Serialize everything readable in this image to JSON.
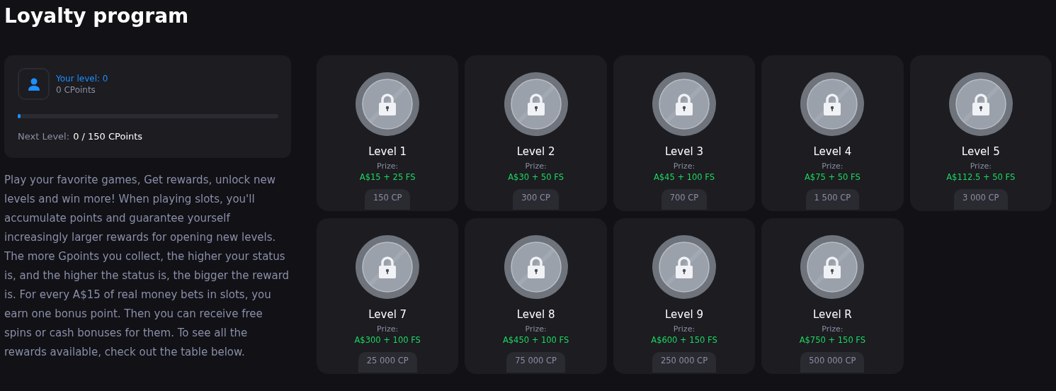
{
  "title": "Loyalty program",
  "status": {
    "level_label": "Your level: 0",
    "points": "0 CPoints",
    "progress": {
      "level": 0
    },
    "next_label": "Next Level:",
    "next_value": "0 / 150 CPoints"
  },
  "description": "Play your favorite games, Get rewards, unlock new levels and win more! When playing slots, you'll accumulate points and guarantee yourself increasingly larger rewards for opening new levels. The more Gpoints you collect, the higher your status is, and the higher the status is, the bigger the reward is. For every A$15 of real money bets in slots, you earn one bonus point. Then you can receive free spins or cash bonuses for them. To see all the rewards available, check out the table below.",
  "levels": [
    {
      "name": "Level 1",
      "prize_label": "Prize:",
      "prize": "A$15 + 25 FS",
      "cost": "150 CP",
      "locked": true
    },
    {
      "name": "Level 2",
      "prize_label": "Prize:",
      "prize": "A$30 + 50 FS",
      "cost": "300 CP",
      "locked": true
    },
    {
      "name": "Level 3",
      "prize_label": "Prize:",
      "prize": "A$45 + 100 FS",
      "cost": "700 CP",
      "locked": true
    },
    {
      "name": "Level 4",
      "prize_label": "Prize:",
      "prize": "A$75 + 50 FS",
      "cost": "1 500 CP",
      "locked": true
    },
    {
      "name": "Level 5",
      "prize_label": "Prize:",
      "prize": "A$112.5 + 50 FS",
      "cost": "3 000 CP",
      "locked": true
    },
    {
      "name": "Level 7",
      "prize_label": "Prize:",
      "prize": "A$300 + 100 FS",
      "cost": "25 000 CP",
      "locked": true
    },
    {
      "name": "Level 8",
      "prize_label": "Prize:",
      "prize": "A$450 + 100 FS",
      "cost": "75 000 CP",
      "locked": true
    },
    {
      "name": "Level 9",
      "prize_label": "Prize:",
      "prize": "A$600 + 150 FS",
      "cost": "250 000 CP",
      "locked": true
    },
    {
      "name": "Level R",
      "prize_label": "Prize:",
      "prize": "A$750 + 150 FS",
      "cost": "500 000 CP",
      "locked": true
    }
  ]
}
